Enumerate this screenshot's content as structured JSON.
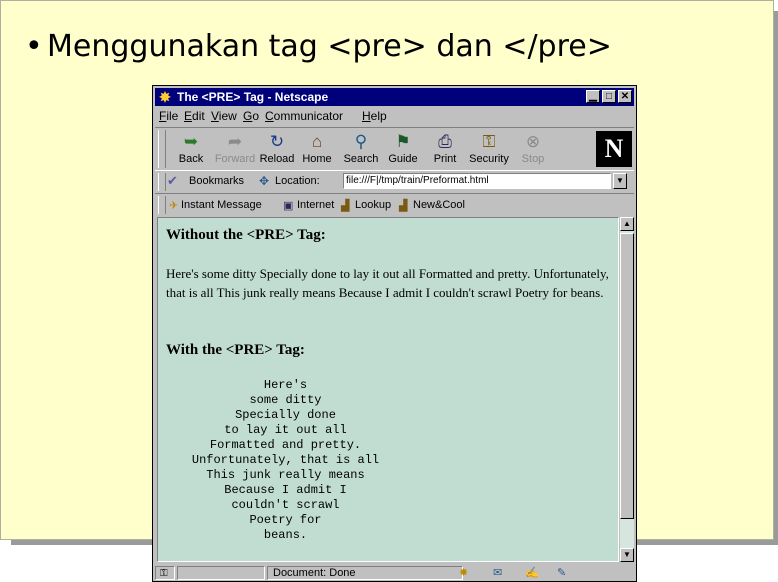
{
  "slide": {
    "bullet_symbol": "•",
    "bullet_text": "Menggunakan tag <pre> dan </pre>"
  },
  "window": {
    "title": "The <PRE> Tag - Netscape",
    "app_icon": "netscape-icon",
    "controls": {
      "minimize": "▁",
      "maximize": "□",
      "close": "✕"
    }
  },
  "menu": [
    "File",
    "Edit",
    "View",
    "Go",
    "Communicator",
    "Help"
  ],
  "navigation_toolbar": [
    {
      "label": "Back",
      "icon": "back-arrow-icon",
      "glyph": "➥",
      "enabled": true
    },
    {
      "label": "Forward",
      "icon": "forward-arrow-icon",
      "glyph": "➦",
      "enabled": false
    },
    {
      "label": "Reload",
      "icon": "reload-icon",
      "glyph": "↻",
      "enabled": true
    },
    {
      "label": "Home",
      "icon": "home-icon",
      "glyph": "⌂",
      "enabled": true
    },
    {
      "label": "Search",
      "icon": "search-icon",
      "glyph": "⚲",
      "enabled": true
    },
    {
      "label": "Guide",
      "icon": "guide-icon",
      "glyph": "⚑",
      "enabled": true
    },
    {
      "label": "Print",
      "icon": "print-icon",
      "glyph": "⎙",
      "enabled": true
    },
    {
      "label": "Security",
      "icon": "lock-icon",
      "glyph": "⚿",
      "enabled": true
    },
    {
      "label": "Stop",
      "icon": "stop-icon",
      "glyph": "⊗",
      "enabled": false
    }
  ],
  "logo_letter": "N",
  "location_toolbar": {
    "bookmarks_label": "Bookmarks",
    "location_label": "Location:",
    "url": "file:///F|/tmp/train/Preformat.html"
  },
  "personal_toolbar": [
    "Instant Message",
    "Internet",
    "Lookup",
    "New&Cool"
  ],
  "page": {
    "heading_without": "Without the <PRE> Tag:",
    "paragraph": "Here's some ditty Specially done to lay it out all Formatted and pretty. Unfortunately, that is all This junk really means Because I admit I couldn't scrawl Poetry for beans.",
    "heading_with": "With the <PRE> Tag:",
    "pre_lines": [
      "Here's",
      "some ditty",
      "Specially done",
      "to lay it out all",
      "Formatted and pretty.",
      "Unfortunately, that is all",
      "This junk really means",
      "Because I admit I",
      "couldn't scrawl",
      "Poetry for",
      "beans."
    ]
  },
  "status": {
    "text": "Document: Done"
  },
  "colors": {
    "slide_background": "#ffffcc",
    "title_bar": "#00007b",
    "page_background": "#c1ddd2",
    "chrome": "#c0c0c0"
  }
}
